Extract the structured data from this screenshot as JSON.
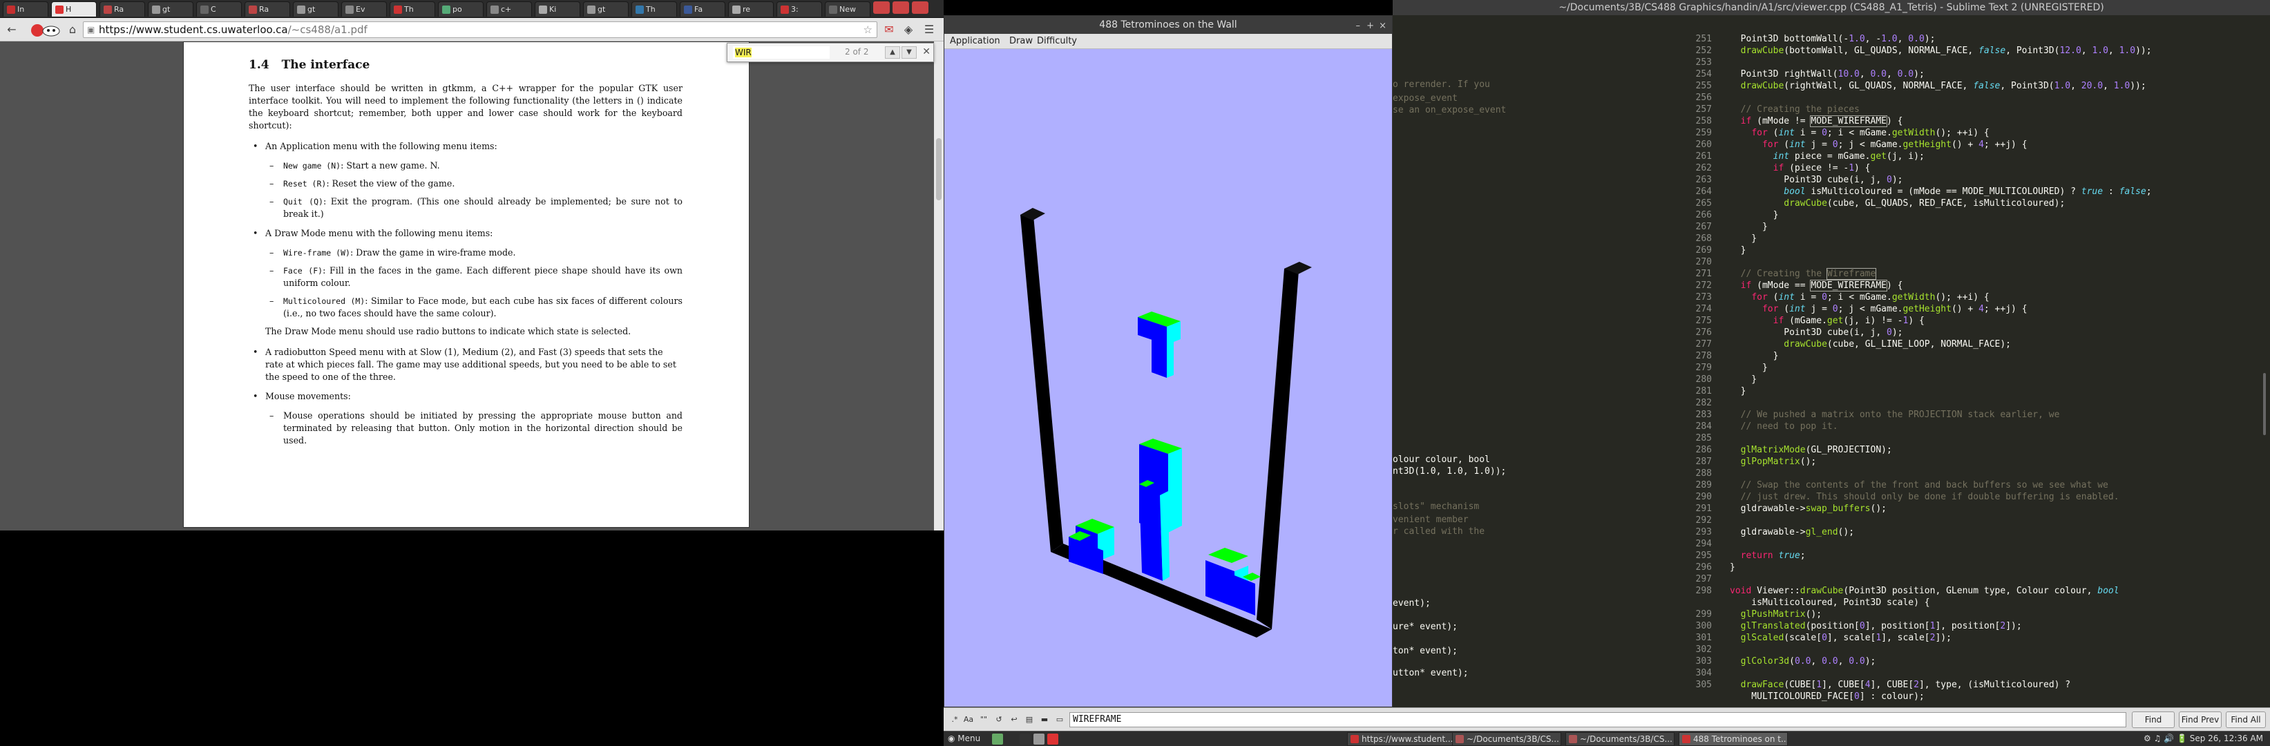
{
  "browser": {
    "tabs": [
      {
        "label": "In",
        "color": "#c42f2f"
      },
      {
        "label": "H",
        "color": "#d33",
        "active": true
      },
      {
        "label": "Ra",
        "color": "#b44"
      },
      {
        "label": "gt",
        "color": "#999"
      },
      {
        "label": "C",
        "color": "#666"
      },
      {
        "label": "Ra",
        "color": "#b44"
      },
      {
        "label": "gt",
        "color": "#999"
      },
      {
        "label": "Ev",
        "color": "#888"
      },
      {
        "label": "Th",
        "color": "#c33"
      },
      {
        "label": "po",
        "color": "#5a7"
      },
      {
        "label": "c+",
        "color": "#888"
      },
      {
        "label": "Ki",
        "color": "#aaa"
      },
      {
        "label": "gt",
        "color": "#999"
      },
      {
        "label": "Th",
        "color": "#37a"
      },
      {
        "label": "Fa",
        "color": "#3b5998"
      },
      {
        "label": "re",
        "color": "#aaa"
      },
      {
        "label": "3:",
        "color": "#c33"
      },
      {
        "label": "New",
        "color": "#666"
      }
    ],
    "url_host": "https://www.student.cs.uwaterloo.ca",
    "url_rest": "/~cs488/a1.pdf",
    "find": {
      "query": "WIR",
      "count": "2 of 2"
    }
  },
  "pdf": {
    "section_num": "1.4",
    "section_title": "The interface",
    "intro": "The user interface should be written in gtkmm, a C++ wrapper for the popular GTK user interface toolkit. You will need to implement the following functionality (the letters in () indicate the keyboard shortcut; remember, both upper and lower case should work for the keyboard shortcut):",
    "app_menu_intro": "An Application menu with the following menu items:",
    "app_items": [
      {
        "code": "New game (N)",
        "text": ": Start a new game. N."
      },
      {
        "code": "Reset (R)",
        "text": ": Reset the view of the game."
      },
      {
        "code": "Quit (Q)",
        "text": ": Exit the program. (This one should already be implemented; be sure not to break it.)"
      }
    ],
    "draw_menu_intro": "A Draw Mode menu with the following menu items:",
    "draw_items": [
      {
        "code": "Wire-frame (W)",
        "text": ": Draw the game in wire-frame mode."
      },
      {
        "code": "Face (F)",
        "text": ": Fill in the faces in the game. Each different piece shape should have its own uniform colour."
      },
      {
        "code": "Multicoloured (M)",
        "text": ": Similar to Face mode, but each cube has six faces of different colours (i.e., no two faces should have the same colour)."
      }
    ],
    "radio_note": "The Draw Mode menu should use radio buttons to indicate which state is selected.",
    "speed": "A radiobutton Speed menu with at Slow (1), Medium (2), and Fast (3) speeds that sets the rate at which pieces fall. The game may use additional speeds, but you need to be able to set the speed to one of the three.",
    "mouse_intro": "Mouse movements:",
    "mouse_items": [
      "Mouse operations should be initiated by pressing the appropriate mouse button and terminated by releasing that button. Only motion in the horizontal direction should be used."
    ]
  },
  "glwindow": {
    "title": "488 Tetrominoes on the Wall",
    "menus": [
      "Application",
      "Draw",
      "Difficulty"
    ],
    "colors": {
      "background": "#b0b0ff",
      "front": "#0000ff",
      "top": "#00ff00",
      "side": "#00ffff",
      "wall": "#000000"
    }
  },
  "editor": {
    "title": "~/Documents/3B/CS488 Graphics/handin/A1/src/viewer.cpp (CS488_A1_Tetris) - Sublime Text 2 (UNREGISTERED)",
    "left_fragments": [
      {
        "text": "o rerender. If you",
        "comment": true
      },
      {
        "text": "expose_event",
        "comment": true
      },
      {
        "text": "se an on_expose_event",
        "comment": true
      },
      {
        "text": "olour colour, bool",
        "comment": false
      },
      {
        "text": "nt3D(1.0, 1.0, 1.0));",
        "comment": false
      },
      {
        "text": " slots\" mechanism",
        "comment": true
      },
      {
        "text": "venient member",
        "comment": true
      },
      {
        "text": "r called with the",
        "comment": true
      },
      {
        "text": "event);",
        "comment": false
      },
      {
        "text": "ure* event);",
        "comment": false
      },
      {
        "text": "ton* event);",
        "comment": false
      },
      {
        "text": "utton* event);",
        "comment": false
      }
    ],
    "line_start": 251,
    "lines": [
      "  Point3D bottomWall(-1.0, -1.0, 0.0);",
      "  drawCube(bottomWall, GL_QUADS, NORMAL_FACE, false, Point3D(12.0, 1.0, 1.0));",
      "",
      "  Point3D rightWall(10.0, 0.0, 0.0);",
      "  drawCube(rightWall, GL_QUADS, NORMAL_FACE, false, Point3D(1.0, 20.0, 1.0));",
      "",
      "  // Creating the pieces",
      "  if (mMode != MODE_WIREFRAME) {",
      "    for (int i = 0; i < mGame.getWidth(); ++i) {",
      "      for (int j = 0; j < mGame.getHeight() + 4; ++j) {",
      "        int piece = mGame.get(j, i);",
      "        if (piece != -1) {",
      "          Point3D cube(i, j, 0);",
      "          bool isMulticoloured = (mMode == MODE_MULTICOLOURED) ? true : false;",
      "          drawCube(cube, GL_QUADS, RED_FACE, isMulticoloured);",
      "        }",
      "      }",
      "    }",
      "  }",
      "",
      "  // Creating the Wireframe",
      "  if (mMode == MODE_WIREFRAME) {",
      "    for (int i = 0; i < mGame.getWidth(); ++i) {",
      "      for (int j = 0; j < mGame.getHeight() + 4; ++j) {",
      "        if (mGame.get(j, i) != -1) {",
      "          Point3D cube(i, j, 0);",
      "          drawCube(cube, GL_LINE_LOOP, NORMAL_FACE);",
      "        }",
      "      }",
      "    }",
      "  }",
      "",
      "  // We pushed a matrix onto the PROJECTION stack earlier, we",
      "  // need to pop it.",
      "",
      "  glMatrixMode(GL_PROJECTION);",
      "  glPopMatrix();",
      "",
      "  // Swap the contents of the front and back buffers so we see what we",
      "  // just drew. This should only be done if double buffering is enabled.",
      "  gldrawable->swap_buffers();",
      "",
      "  gldrawable->gl_end();",
      "",
      "  return true;",
      "}",
      "",
      "void Viewer::drawCube(Point3D position, GLenum type, Colour colour, bool",
      "    isMulticoloured, Point3D scale) {",
      "  glPushMatrix();",
      "  glTranslated(position[0], position[1], position[2]);",
      "  glScaled(scale[0], scale[1], scale[2]);",
      "",
      "  glColor3d(0.0, 0.0, 0.0);",
      "",
      "  drawFace(CUBE[1], CUBE[4], CUBE[2], type, (isMulticoloured) ?",
      "    MULTICOLOURED_FACE[0] : colour);"
    ],
    "line_numbers": [
      "251",
      "252",
      "253",
      "254",
      "255",
      "256",
      "257",
      "258",
      "259",
      "260",
      "261",
      "262",
      "263",
      "264",
      "265",
      "266",
      "267",
      "268",
      "269",
      "270",
      "271",
      "272",
      "273",
      "274",
      "275",
      "276",
      "277",
      "278",
      "279",
      "280",
      "281",
      "282",
      "283",
      "284",
      "285",
      "286",
      "287",
      "288",
      "289",
      "290",
      "291",
      "292",
      "293",
      "294",
      "295",
      "296",
      "297",
      "298",
      "",
      "299",
      "300",
      "301",
      "302",
      "303",
      "304",
      "305",
      ""
    ]
  },
  "findpanel": {
    "value": "WIREFRAME",
    "find": "Find",
    "find_prev": "Find Prev",
    "find_all": "Find All"
  },
  "taskbar": {
    "menu": "Menu",
    "tasks": [
      {
        "label": "https://www.student...",
        "color": "#c33"
      },
      {
        "label": "~/Documents/3B/CS...",
        "color": "#a55"
      },
      {
        "label": "~/Documents/3B/CS...",
        "color": "#a55"
      },
      {
        "label": "488 Tetrominoes on t...",
        "color": "#c33",
        "active": true
      }
    ],
    "clock": "Sep 26, 12:36 AM"
  }
}
